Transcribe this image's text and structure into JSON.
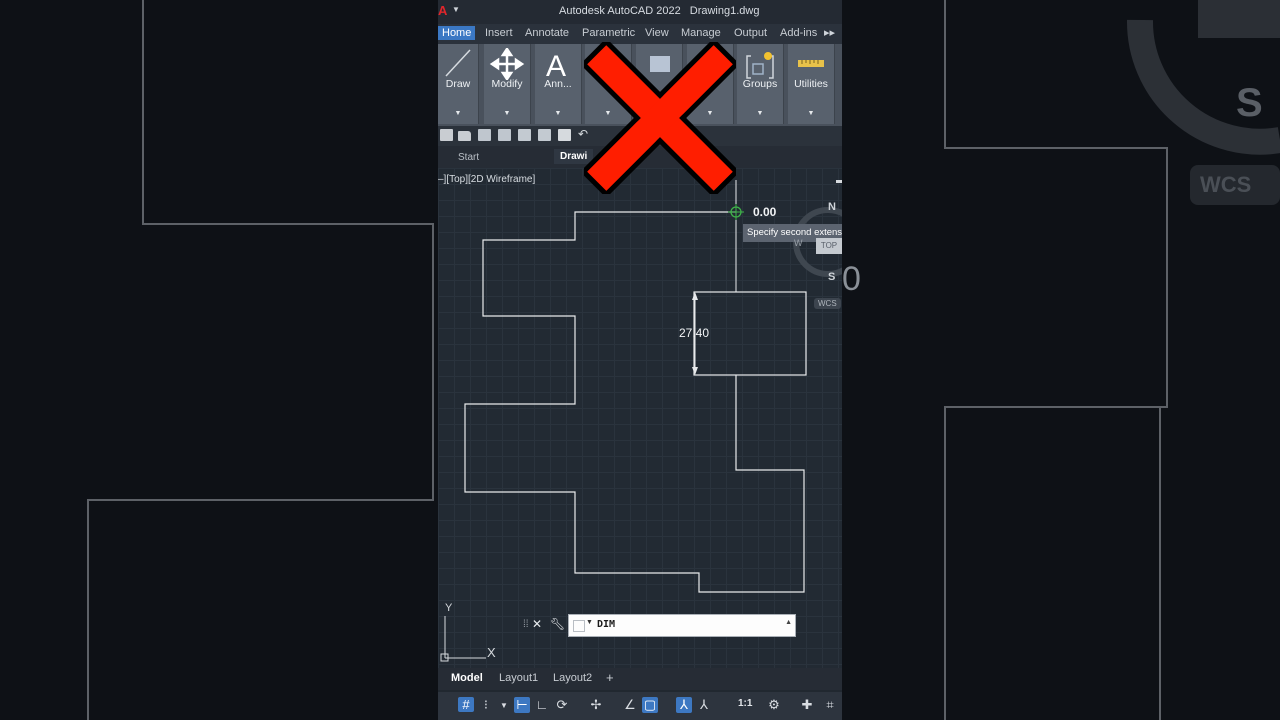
{
  "window": {
    "title_app": "Autodesk AutoCAD 2022",
    "title_file": "Drawing1.dwg"
  },
  "ribbon": {
    "tabs": [
      {
        "label": "Home",
        "active": true
      },
      {
        "label": "Insert"
      },
      {
        "label": "Annotate"
      },
      {
        "label": "Parametric"
      },
      {
        "label": "View"
      },
      {
        "label": "Manage"
      },
      {
        "label": "Output"
      },
      {
        "label": "Add-ins"
      }
    ],
    "more": "▸▸",
    "panels": [
      {
        "label": "Draw",
        "icon": "line-icon"
      },
      {
        "label": "Modify",
        "icon": "move-icon"
      },
      {
        "label": "Ann...",
        "icon": "text-a-icon"
      },
      {
        "label": "",
        "icon": "layers-icon"
      },
      {
        "label": "",
        "icon": "block-icon"
      },
      {
        "label": "",
        "icon": "properties-icon"
      },
      {
        "label": "Groups",
        "icon": "groups-icon"
      },
      {
        "label": "Utilities",
        "icon": "measure-icon"
      }
    ]
  },
  "file_tabs": {
    "start": "Start",
    "drawing": "Drawi"
  },
  "viewport": {
    "label": "–][Top][2D Wireframe]",
    "dim_value": "27.40",
    "cursor_value": "0.00",
    "tooltip": "Specify second extension line origin",
    "compass": {
      "n": "N",
      "s": "S",
      "w": "W",
      "top": "TOP"
    },
    "wcs": "WCS",
    "ucs_x": "X",
    "ucs_y": "Y"
  },
  "command_line": {
    "text": "DIM"
  },
  "layout_tabs": {
    "model": "Model",
    "layout1": "Layout1",
    "layout2": "Layout2",
    "add": "+"
  },
  "status_bar": {
    "scale": "1:1"
  },
  "background": {
    "zoom_s": "S",
    "zoom_wcs": "WCS",
    "zoom_zero": "0"
  },
  "overlay": {
    "icon": "red-x-icon",
    "color": "#ff1e00"
  },
  "colors": {
    "accent": "#3b78c4",
    "canvas": "#222a33",
    "brand_red": "#e0262b"
  }
}
